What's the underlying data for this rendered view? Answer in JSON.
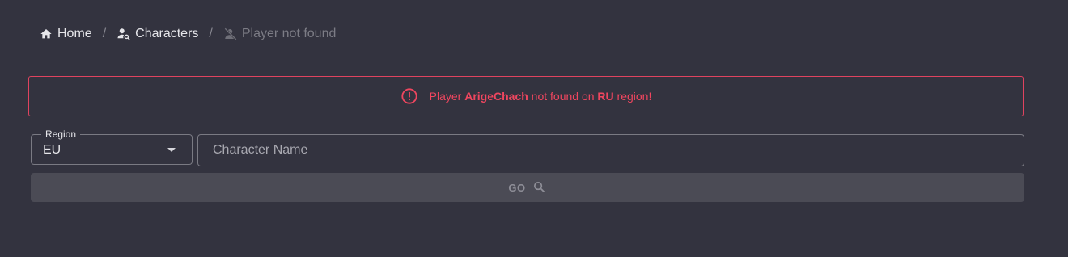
{
  "breadcrumb": {
    "items": [
      {
        "label": "Home",
        "icon": "home-icon"
      },
      {
        "label": "Characters",
        "icon": "user-search-icon"
      },
      {
        "label": "Player not found",
        "icon": "user-off-icon"
      }
    ],
    "separator": "/"
  },
  "alert": {
    "prefix": "Player",
    "player": "ArigeChach",
    "middle": "not found on",
    "region": "RU",
    "suffix": "region!",
    "icon": "alert-circle-icon",
    "color": "#f0465f"
  },
  "form": {
    "region_label": "Region",
    "region_value": "EU",
    "name_placeholder": "Character Name",
    "go_label": "GO",
    "go_icon": "search-icon"
  },
  "colors": {
    "background": "#33333f",
    "error": "#f0465f",
    "button_bg": "#4b4b55"
  }
}
